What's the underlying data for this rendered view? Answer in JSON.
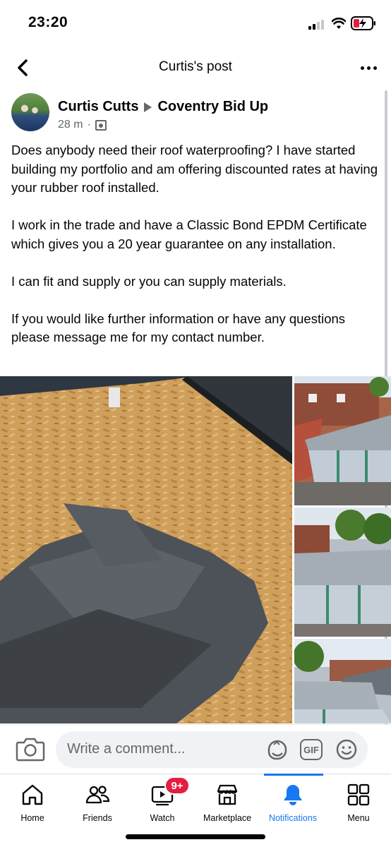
{
  "status_bar": {
    "time": "23:20"
  },
  "header": {
    "title": "Curtis's post"
  },
  "post": {
    "author": "Curtis Cutts",
    "group": "Coventry Bid Up",
    "time": "28 m",
    "separator": "·",
    "paragraphs": [
      "Does anybody need their roof waterproofing? I have started building my portfolio and am offering discounted rates at having your rubber roof installed.",
      "I work in the trade and have a Classic Bond EPDM Certificate which gives you a 20 year guarantee on any installation.",
      "I can fit and supply or you can supply materials.",
      "If you would like further information or have any questions please message me for my contact number."
    ]
  },
  "comment": {
    "placeholder": "Write a comment...",
    "gif_label": "GIF"
  },
  "tabs": [
    {
      "label": "Home",
      "icon": "home-icon"
    },
    {
      "label": "Friends",
      "icon": "friends-icon"
    },
    {
      "label": "Watch",
      "icon": "watch-icon"
    },
    {
      "label": "Marketplace",
      "icon": "marketplace-icon"
    },
    {
      "label": "Notifications",
      "icon": "bell-icon"
    },
    {
      "label": "Menu",
      "icon": "menu-grid-icon"
    }
  ],
  "watch_badge": "9+",
  "colors": {
    "accent": "#1877f2",
    "badge": "#e41e3f",
    "secondary_text": "#65676b"
  }
}
